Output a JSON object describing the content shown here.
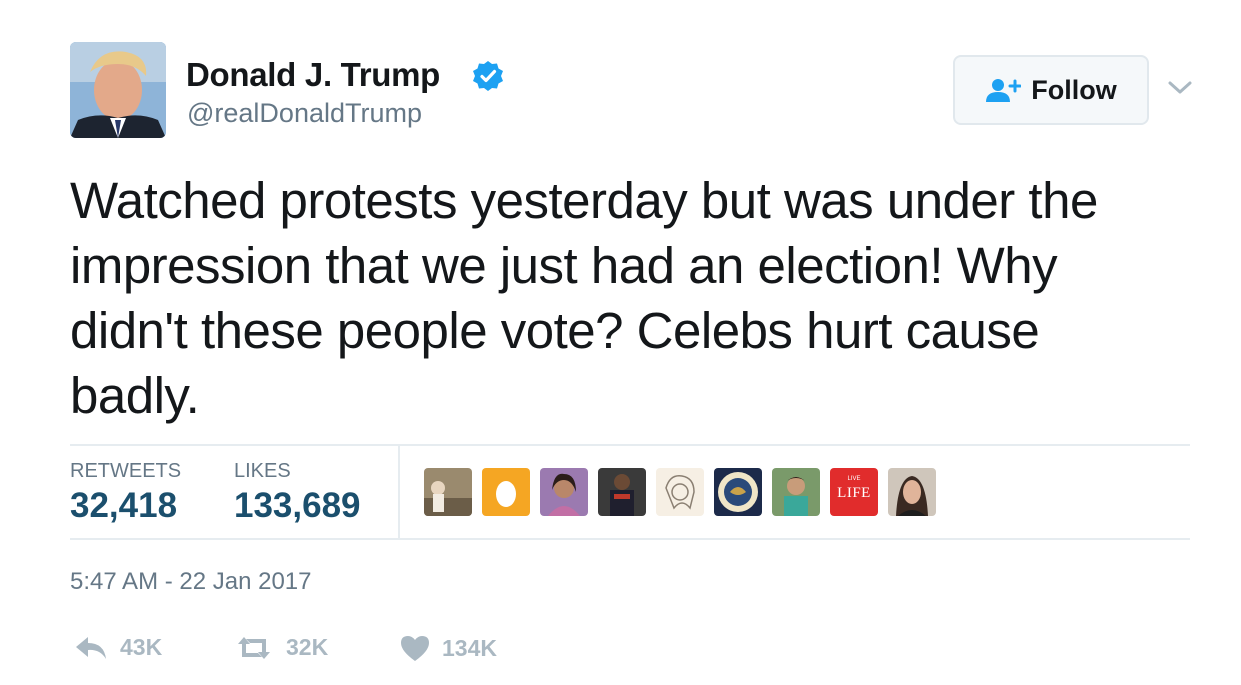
{
  "user": {
    "display_name": "Donald J. Trump",
    "handle": "@realDonaldTrump",
    "verified": true
  },
  "follow_button": {
    "label": "Follow"
  },
  "tweet": {
    "text": "Watched protests yesterday but was under the impression that we just had an election! Why didn't these people vote? Celebs hurt cause badly.",
    "timestamp": "5:47 AM - 22 Jan 2017"
  },
  "stats": {
    "retweets_label": "RETWEETS",
    "retweets_value": "32,418",
    "likes_label": "LIKES",
    "likes_value": "133,689"
  },
  "likers": [
    {
      "name": "liker-avatar-1"
    },
    {
      "name": "liker-avatar-2-egg"
    },
    {
      "name": "liker-avatar-3"
    },
    {
      "name": "liker-avatar-4"
    },
    {
      "name": "liker-avatar-5"
    },
    {
      "name": "liker-avatar-6-seal"
    },
    {
      "name": "liker-avatar-7"
    },
    {
      "name": "liker-avatar-8-live-life",
      "small_text": "LIVE",
      "text": "LIFE"
    },
    {
      "name": "liker-avatar-9"
    }
  ],
  "actions": {
    "reply_count": "43K",
    "retweet_count": "32K",
    "like_count": "134K"
  },
  "colors": {
    "verified": "#1da1f2",
    "follow_icon": "#1da1f2",
    "stat_value": "#1b4f6d",
    "muted": "#657786",
    "action_icon": "#aab8c2"
  }
}
